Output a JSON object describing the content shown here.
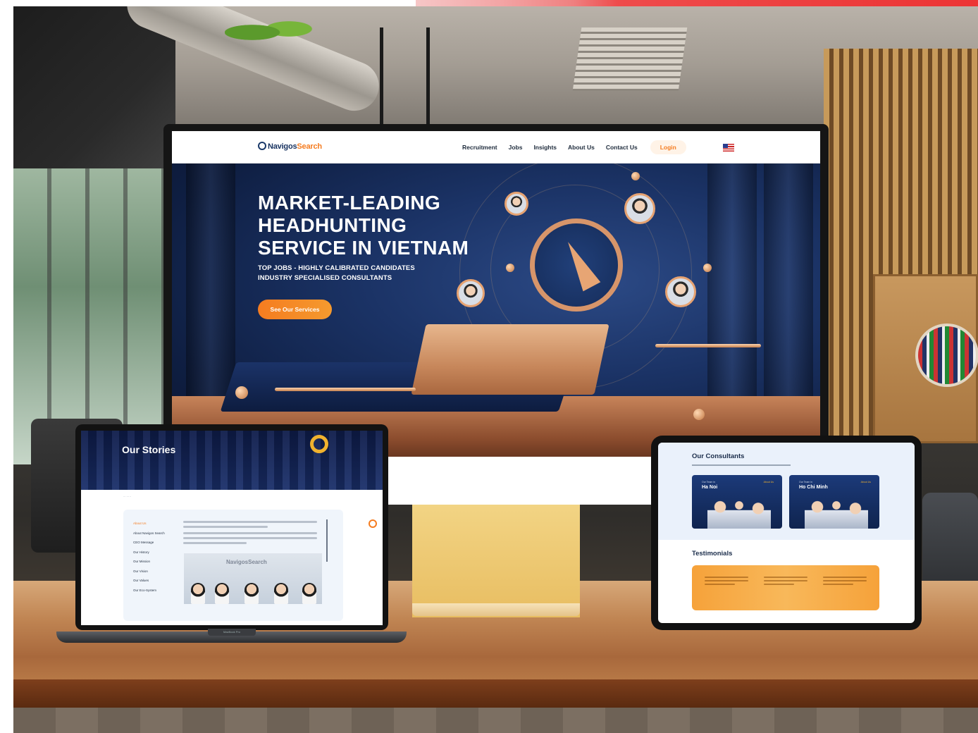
{
  "monitor": {
    "logo": {
      "brand": "Navigos",
      "accent": "Search"
    },
    "nav": {
      "items": [
        "Recruitment",
        "Jobs",
        "Insights",
        "About Us",
        "Contact Us"
      ],
      "login": "Login"
    },
    "hero": {
      "title_lines": [
        "MARKET-LEADING",
        "HEADHUNTING",
        "SERVICE IN VIETNAM"
      ],
      "subtitle_lines": [
        "TOP JOBS - HIGHLY CALIBRATED CANDIDATES",
        "INDUSTRY SPECIALISED CONSULTANTS"
      ],
      "cta": "See Our Services"
    }
  },
  "laptop": {
    "banner_title": "Our Stories",
    "sidebar": [
      "About Us",
      "About Navigos Search",
      "CEO Message",
      "Our History",
      "Our Mission",
      "Our Vision",
      "Our Values",
      "Our Eco-System"
    ],
    "photo_logo": "NavigosSearch",
    "base_label": "MacBook Pro"
  },
  "tablet": {
    "consultants_heading": "Our Consultants",
    "offices": [
      {
        "caption": "Our Team in",
        "name": "Ha Noi",
        "link": "About Us"
      },
      {
        "caption": "Our Team in",
        "name": "Ho Chi Minh",
        "link": "About Us"
      }
    ],
    "testimonials_heading": "Testimonials"
  },
  "colors": {
    "accent_orange": "#f57c20",
    "navy": "#1b3366",
    "brand_blue": "#16315f"
  },
  "icons": [
    "flag-us-icon",
    "compass-icon"
  ]
}
